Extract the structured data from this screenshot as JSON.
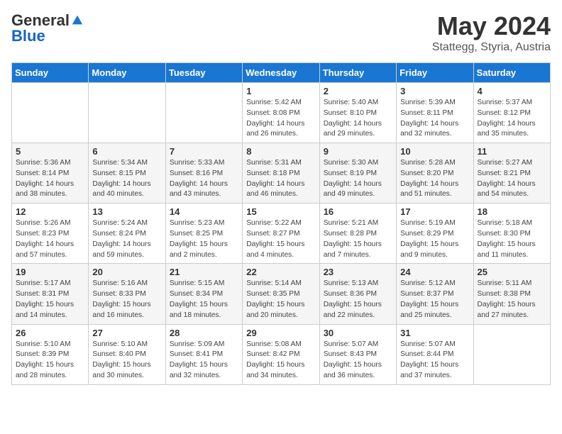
{
  "header": {
    "logo_general": "General",
    "logo_blue": "Blue",
    "month_title": "May 2024",
    "subtitle": "Stattegg, Styria, Austria"
  },
  "days_of_week": [
    "Sunday",
    "Monday",
    "Tuesday",
    "Wednesday",
    "Thursday",
    "Friday",
    "Saturday"
  ],
  "weeks": [
    [
      null,
      null,
      null,
      {
        "day": "1",
        "sunrise": "5:42 AM",
        "sunset": "8:08 PM",
        "daylight": "14 hours and 26 minutes."
      },
      {
        "day": "2",
        "sunrise": "5:40 AM",
        "sunset": "8:10 PM",
        "daylight": "14 hours and 29 minutes."
      },
      {
        "day": "3",
        "sunrise": "5:39 AM",
        "sunset": "8:11 PM",
        "daylight": "14 hours and 32 minutes."
      },
      {
        "day": "4",
        "sunrise": "5:37 AM",
        "sunset": "8:12 PM",
        "daylight": "14 hours and 35 minutes."
      }
    ],
    [
      {
        "day": "5",
        "sunrise": "5:36 AM",
        "sunset": "8:14 PM",
        "daylight": "14 hours and 38 minutes."
      },
      {
        "day": "6",
        "sunrise": "5:34 AM",
        "sunset": "8:15 PM",
        "daylight": "14 hours and 40 minutes."
      },
      {
        "day": "7",
        "sunrise": "5:33 AM",
        "sunset": "8:16 PM",
        "daylight": "14 hours and 43 minutes."
      },
      {
        "day": "8",
        "sunrise": "5:31 AM",
        "sunset": "8:18 PM",
        "daylight": "14 hours and 46 minutes."
      },
      {
        "day": "9",
        "sunrise": "5:30 AM",
        "sunset": "8:19 PM",
        "daylight": "14 hours and 49 minutes."
      },
      {
        "day": "10",
        "sunrise": "5:28 AM",
        "sunset": "8:20 PM",
        "daylight": "14 hours and 51 minutes."
      },
      {
        "day": "11",
        "sunrise": "5:27 AM",
        "sunset": "8:21 PM",
        "daylight": "14 hours and 54 minutes."
      }
    ],
    [
      {
        "day": "12",
        "sunrise": "5:26 AM",
        "sunset": "8:23 PM",
        "daylight": "14 hours and 57 minutes."
      },
      {
        "day": "13",
        "sunrise": "5:24 AM",
        "sunset": "8:24 PM",
        "daylight": "14 hours and 59 minutes."
      },
      {
        "day": "14",
        "sunrise": "5:23 AM",
        "sunset": "8:25 PM",
        "daylight": "15 hours and 2 minutes."
      },
      {
        "day": "15",
        "sunrise": "5:22 AM",
        "sunset": "8:27 PM",
        "daylight": "15 hours and 4 minutes."
      },
      {
        "day": "16",
        "sunrise": "5:21 AM",
        "sunset": "8:28 PM",
        "daylight": "15 hours and 7 minutes."
      },
      {
        "day": "17",
        "sunrise": "5:19 AM",
        "sunset": "8:29 PM",
        "daylight": "15 hours and 9 minutes."
      },
      {
        "day": "18",
        "sunrise": "5:18 AM",
        "sunset": "8:30 PM",
        "daylight": "15 hours and 11 minutes."
      }
    ],
    [
      {
        "day": "19",
        "sunrise": "5:17 AM",
        "sunset": "8:31 PM",
        "daylight": "15 hours and 14 minutes."
      },
      {
        "day": "20",
        "sunrise": "5:16 AM",
        "sunset": "8:33 PM",
        "daylight": "15 hours and 16 minutes."
      },
      {
        "day": "21",
        "sunrise": "5:15 AM",
        "sunset": "8:34 PM",
        "daylight": "15 hours and 18 minutes."
      },
      {
        "day": "22",
        "sunrise": "5:14 AM",
        "sunset": "8:35 PM",
        "daylight": "15 hours and 20 minutes."
      },
      {
        "day": "23",
        "sunrise": "5:13 AM",
        "sunset": "8:36 PM",
        "daylight": "15 hours and 22 minutes."
      },
      {
        "day": "24",
        "sunrise": "5:12 AM",
        "sunset": "8:37 PM",
        "daylight": "15 hours and 25 minutes."
      },
      {
        "day": "25",
        "sunrise": "5:11 AM",
        "sunset": "8:38 PM",
        "daylight": "15 hours and 27 minutes."
      }
    ],
    [
      {
        "day": "26",
        "sunrise": "5:10 AM",
        "sunset": "8:39 PM",
        "daylight": "15 hours and 28 minutes."
      },
      {
        "day": "27",
        "sunrise": "5:10 AM",
        "sunset": "8:40 PM",
        "daylight": "15 hours and 30 minutes."
      },
      {
        "day": "28",
        "sunrise": "5:09 AM",
        "sunset": "8:41 PM",
        "daylight": "15 hours and 32 minutes."
      },
      {
        "day": "29",
        "sunrise": "5:08 AM",
        "sunset": "8:42 PM",
        "daylight": "15 hours and 34 minutes."
      },
      {
        "day": "30",
        "sunrise": "5:07 AM",
        "sunset": "8:43 PM",
        "daylight": "15 hours and 36 minutes."
      },
      {
        "day": "31",
        "sunrise": "5:07 AM",
        "sunset": "8:44 PM",
        "daylight": "15 hours and 37 minutes."
      },
      null
    ]
  ]
}
